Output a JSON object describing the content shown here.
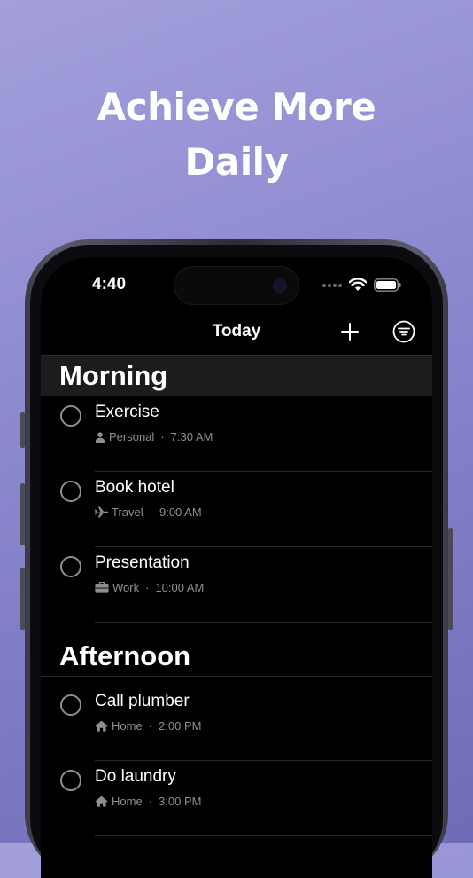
{
  "headline": {
    "line1": "Achieve More",
    "line2": "Daily"
  },
  "status_bar": {
    "time": "4:40"
  },
  "nav": {
    "title": "Today",
    "add_icon": "plus-icon",
    "filter_icon": "filter-icon"
  },
  "sections": [
    {
      "title": "Morning",
      "tasks": [
        {
          "title": "Exercise",
          "category": "Personal",
          "category_icon": "person-icon",
          "time": "7:30 AM"
        },
        {
          "title": "Book hotel",
          "category": "Travel",
          "category_icon": "airplane-icon",
          "time": "9:00 AM"
        },
        {
          "title": "Presentation",
          "category": "Work",
          "category_icon": "briefcase-icon",
          "time": "10:00 AM"
        }
      ]
    },
    {
      "title": "Afternoon",
      "tasks": [
        {
          "title": "Call plumber",
          "category": "Home",
          "category_icon": "house-icon",
          "time": "2:00 PM"
        },
        {
          "title": "Do laundry",
          "category": "Home",
          "category_icon": "house-icon",
          "time": "3:00 PM"
        }
      ]
    }
  ]
}
